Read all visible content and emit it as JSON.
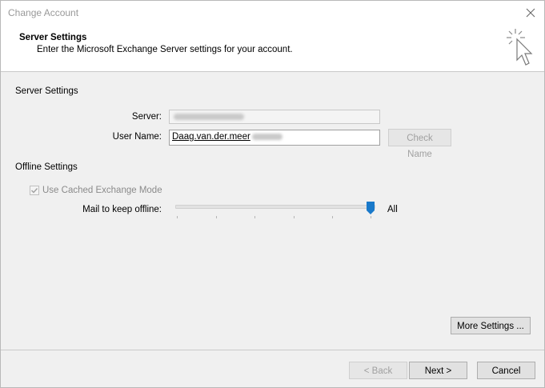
{
  "window": {
    "title": "Change Account",
    "close_icon": "close-icon"
  },
  "header": {
    "title": "Server Settings",
    "subtitle": "Enter the Microsoft Exchange Server settings for your account.",
    "icon": "cursor-sparkle-icon"
  },
  "server_settings": {
    "section_title": "Server Settings",
    "server_label": "Server:",
    "username_label": "User Name:",
    "username_value": "Daag.van.der.meer",
    "check_name_label": "Check Name"
  },
  "offline_settings": {
    "section_title": "Offline Settings",
    "cached_mode_label": "Use Cached Exchange Mode",
    "cached_mode_checked": true,
    "mail_keep_label": "Mail to keep offline:",
    "mail_keep_value": "All"
  },
  "buttons": {
    "more_settings": "More Settings ...",
    "back": "< Back",
    "next": "Next >",
    "cancel": "Cancel"
  },
  "colors": {
    "slider_thumb": "#1979ca",
    "disabled_text": "#a0a0a0"
  }
}
